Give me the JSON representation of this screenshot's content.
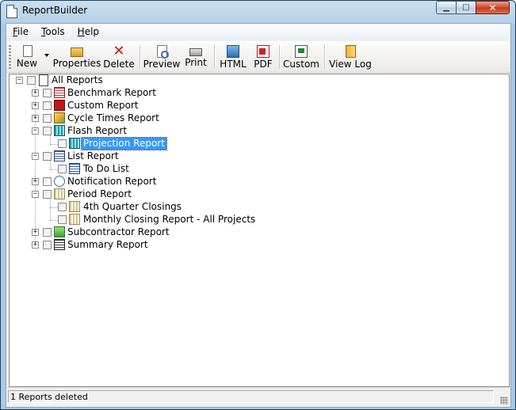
{
  "window": {
    "title": "ReportBuilder",
    "minimize_icon": "minimize-glyph",
    "maximize_icon": "maximize-glyph",
    "close_icon": "close-glyph"
  },
  "menu": {
    "file": {
      "accel": "F",
      "rest": "ile"
    },
    "tools": {
      "accel": "T",
      "rest": "ools"
    },
    "help": {
      "accel": "H",
      "rest": "elp"
    }
  },
  "toolbar": {
    "new": "New",
    "properties": "Properties",
    "delete": "Delete",
    "preview": "Preview",
    "print": "Print",
    "html": "HTML",
    "pdf": "PDF",
    "custom": "Custom",
    "view_log": "View Log"
  },
  "tree": {
    "root": "All Reports",
    "benchmark": "Benchmark Report",
    "custom": "Custom Report",
    "cycle_times": "Cycle Times Report",
    "flash": "Flash Report",
    "projection": "Projection Report",
    "list": "List Report",
    "todo": "To Do List",
    "notification": "Notification Report",
    "period": "Period Report",
    "q4_closings": "4th Quarter Closings",
    "monthly_closing": "Monthly Closing Report - All Projects",
    "subcontractor": "Subcontractor Report",
    "summary": "Summary Report",
    "selected_item": "Projection Report"
  },
  "status": {
    "message": "1 Reports deleted"
  },
  "colors": {
    "selection": "#3399ff",
    "close_button": "#c1391a",
    "title_bar": "#b3cfe6"
  }
}
